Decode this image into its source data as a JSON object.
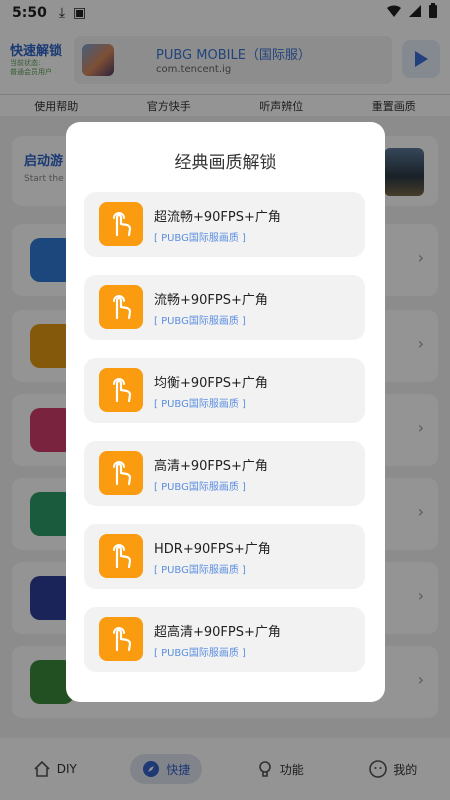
{
  "status_bar": {
    "time": "5:50"
  },
  "header": {
    "brand_title": "快速解锁",
    "brand_sub1": "当前状态:",
    "brand_sub2": "普通会员用户",
    "game_name": "PUBG MOBILE（国际服）",
    "game_package": "com.tencent.ig"
  },
  "quick_tabs": [
    "使用帮助",
    "官方快手",
    "听声辨位",
    "重置画质"
  ],
  "launch_card": {
    "title": "启动游",
    "subtitle": "Start the"
  },
  "feature_list": {
    "items": [
      {
        "color": "#2f7bd8"
      },
      {
        "color": "#e59a14"
      },
      {
        "color": "#d33d6c"
      },
      {
        "color": "#2e9b6a"
      },
      {
        "color": "#2f3f9a"
      },
      {
        "color": "#3c8a3c"
      }
    ]
  },
  "bottom_nav": [
    {
      "label": "DIY",
      "icon": "home-icon"
    },
    {
      "label": "快捷",
      "icon": "compass-icon",
      "active": true
    },
    {
      "label": "功能",
      "icon": "bulb-icon"
    },
    {
      "label": "我的",
      "icon": "face-icon"
    }
  ],
  "dialog": {
    "title": "经典画质解锁",
    "options": [
      {
        "title": "超流畅+90FPS+广角",
        "subtitle": "[ PUBG国际服画质 ]",
        "icon": "hand-pointer-icon"
      },
      {
        "title": "流畅+90FPS+广角",
        "subtitle": "[ PUBG国际服画质 ]",
        "icon": "hand-pointer-icon"
      },
      {
        "title": "均衡+90FPS+广角",
        "subtitle": "[ PUBG国际服画质 ]",
        "icon": "hand-pointer-icon"
      },
      {
        "title": "高清+90FPS+广角",
        "subtitle": "[ PUBG国际服画质 ]",
        "icon": "hand-pointer-icon"
      },
      {
        "title": "HDR+90FPS+广角",
        "subtitle": "[ PUBG国际服画质 ]",
        "icon": "hand-pointer-icon"
      },
      {
        "title": "超高清+90FPS+广角",
        "subtitle": "[ PUBG国际服画质 ]",
        "icon": "hand-pointer-icon"
      }
    ]
  },
  "colors": {
    "accent_orange": "#fa9b10",
    "accent_blue": "#2d64c8",
    "link_blue": "#5b8ee0"
  }
}
